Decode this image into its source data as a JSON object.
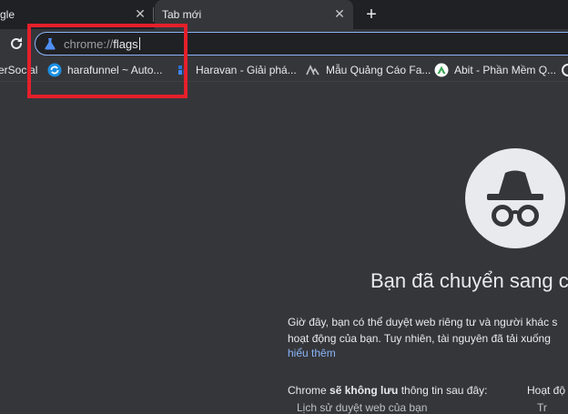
{
  "tabs": {
    "inactive_label": "gle",
    "active_label": "Tab mới",
    "close_glyph": "✕",
    "new_tab_glyph": "+"
  },
  "omnibox": {
    "prefix": "chrome://",
    "value": "flags"
  },
  "bookmarks": [
    {
      "label": "erSocial",
      "icon": "site-icon"
    },
    {
      "label": "harafunnel ~ Auto...",
      "icon": "harafunnel-icon"
    },
    {
      "label": "Haravan - Giải phá...",
      "icon": "haravan-icon"
    },
    {
      "label": "Mẫu Quảng Cáo Fa...",
      "icon": "mountain-logo-icon"
    },
    {
      "label": "Abit - Phần Mềm Q...",
      "icon": "abit-icon"
    }
  ],
  "page": {
    "heading": "Bạn đã chuyển sang chế",
    "paragraph_line1": "Giờ đây, bạn có thể duyệt web riêng tư và người khác s",
    "paragraph_line2": "hoạt động của bạn. Tuy nhiên, tài nguyên đã tải xuống",
    "learn_more": "hiểu thêm",
    "col1_pre": "Chrome ",
    "col1_bold": "sẽ không lưu",
    "col1_post": " thông tin sau đây:",
    "col2_heading": "Hoạt độ",
    "cut1": "Lịch sử duyệt web của bạn",
    "cut2": "Tr"
  },
  "colors": {
    "tabstrip": "#202124",
    "toolbar": "#35363a",
    "accent_blue": "#8ab4f8",
    "annotation_red": "#e5202b"
  }
}
